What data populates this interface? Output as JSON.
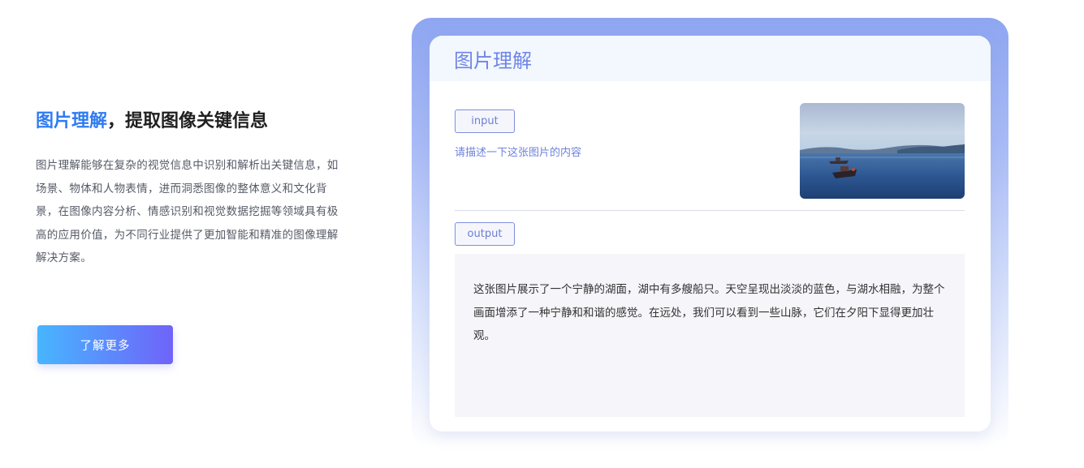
{
  "hero": {
    "headline_highlight": "图片理解",
    "headline_rest": "，提取图像关键信息",
    "description": "图片理解能够在复杂的视觉信息中识别和解析出关键信息，如场景、物体和人物表情，进而洞悉图像的整体意义和文化背景，在图像内容分析、情感识别和视觉数据挖掘等领域具有极高的应用价值，为不同行业提供了更加智能和精准的图像理解解决方案。",
    "cta_label": "了解更多"
  },
  "demo": {
    "title": "图片理解",
    "input_tag": "input",
    "prompt": "请描述一下这张图片的内容",
    "output_tag": "output",
    "answer": "这张图片展示了一个宁静的湖面，湖中有多艘船只。天空呈现出淡淡的蓝色，与湖水相融，为整个画面增添了一种宁静和和谐的感觉。在远处，我们可以看到一些山脉，它们在夕阳下显得更加壮观。"
  },
  "colors": {
    "accent_blue": "#2f7bf2",
    "card_title": "#6f86e6",
    "cta_gradient_start": "#47b6ff",
    "cta_gradient_end": "#6f63f9"
  }
}
